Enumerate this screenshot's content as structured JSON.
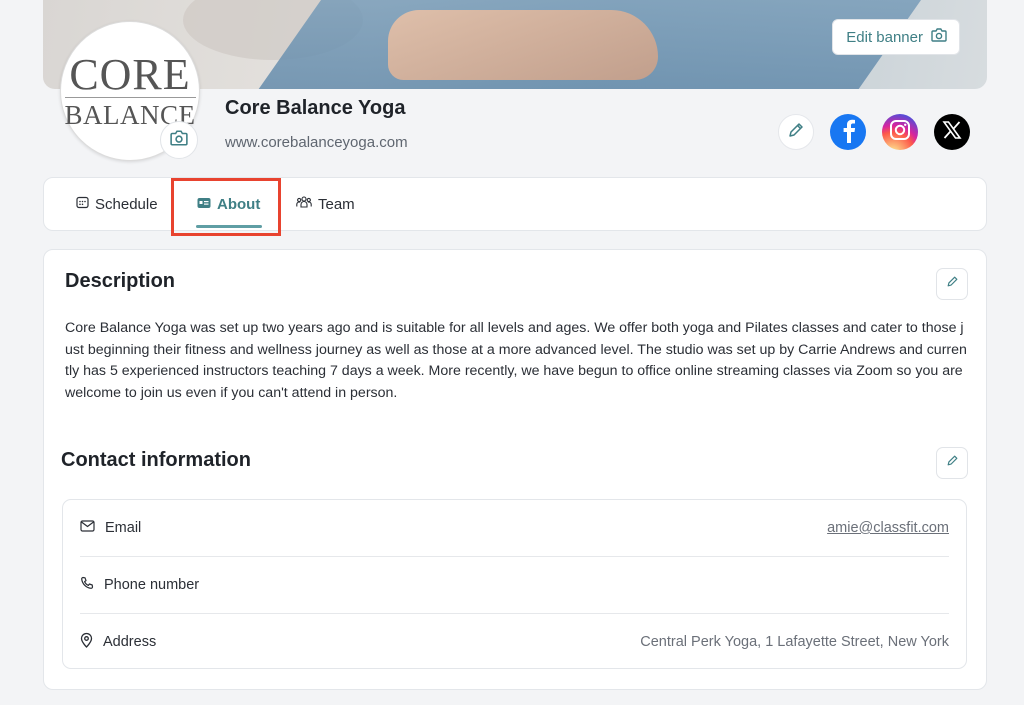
{
  "banner": {
    "edit_label": "Edit banner"
  },
  "logo": {
    "line1": "CORE",
    "line2": "BALANCE"
  },
  "studio": {
    "name": "Core Balance Yoga",
    "url": "www.corebalanceyoga.com"
  },
  "tabs": [
    {
      "label": "Schedule",
      "icon": "calendar-icon"
    },
    {
      "label": "About",
      "icon": "id-card-icon",
      "active": true
    },
    {
      "label": "Team",
      "icon": "team-icon"
    }
  ],
  "description": {
    "title": "Description",
    "text": "Core Balance Yoga was set up two years ago and is suitable for all levels and ages. We offer both yoga and Pilates classes and cater to those just beginning their fitness and wellness journey as well as those at a more advanced level. The studio was set up by Carrie Andrews and currently has 5 experienced instructors teaching 7 days a week. More recently, we have begun to office online streaming classes via Zoom so you are welcome to join us even if you can't attend in person."
  },
  "contact": {
    "title": "Contact information",
    "rows": [
      {
        "label": "Email",
        "value": "amie@classfit.com",
        "icon": "mail-icon"
      },
      {
        "label": "Phone number",
        "value": "",
        "icon": "phone-icon"
      },
      {
        "label": "Address",
        "value": "Central Perk Yoga, 1 Lafayette Street, New York",
        "icon": "map-pin-icon"
      }
    ]
  },
  "colors": {
    "accent": "#3f7f85",
    "highlight": "#e8432f",
    "facebook": "#1877f2"
  }
}
